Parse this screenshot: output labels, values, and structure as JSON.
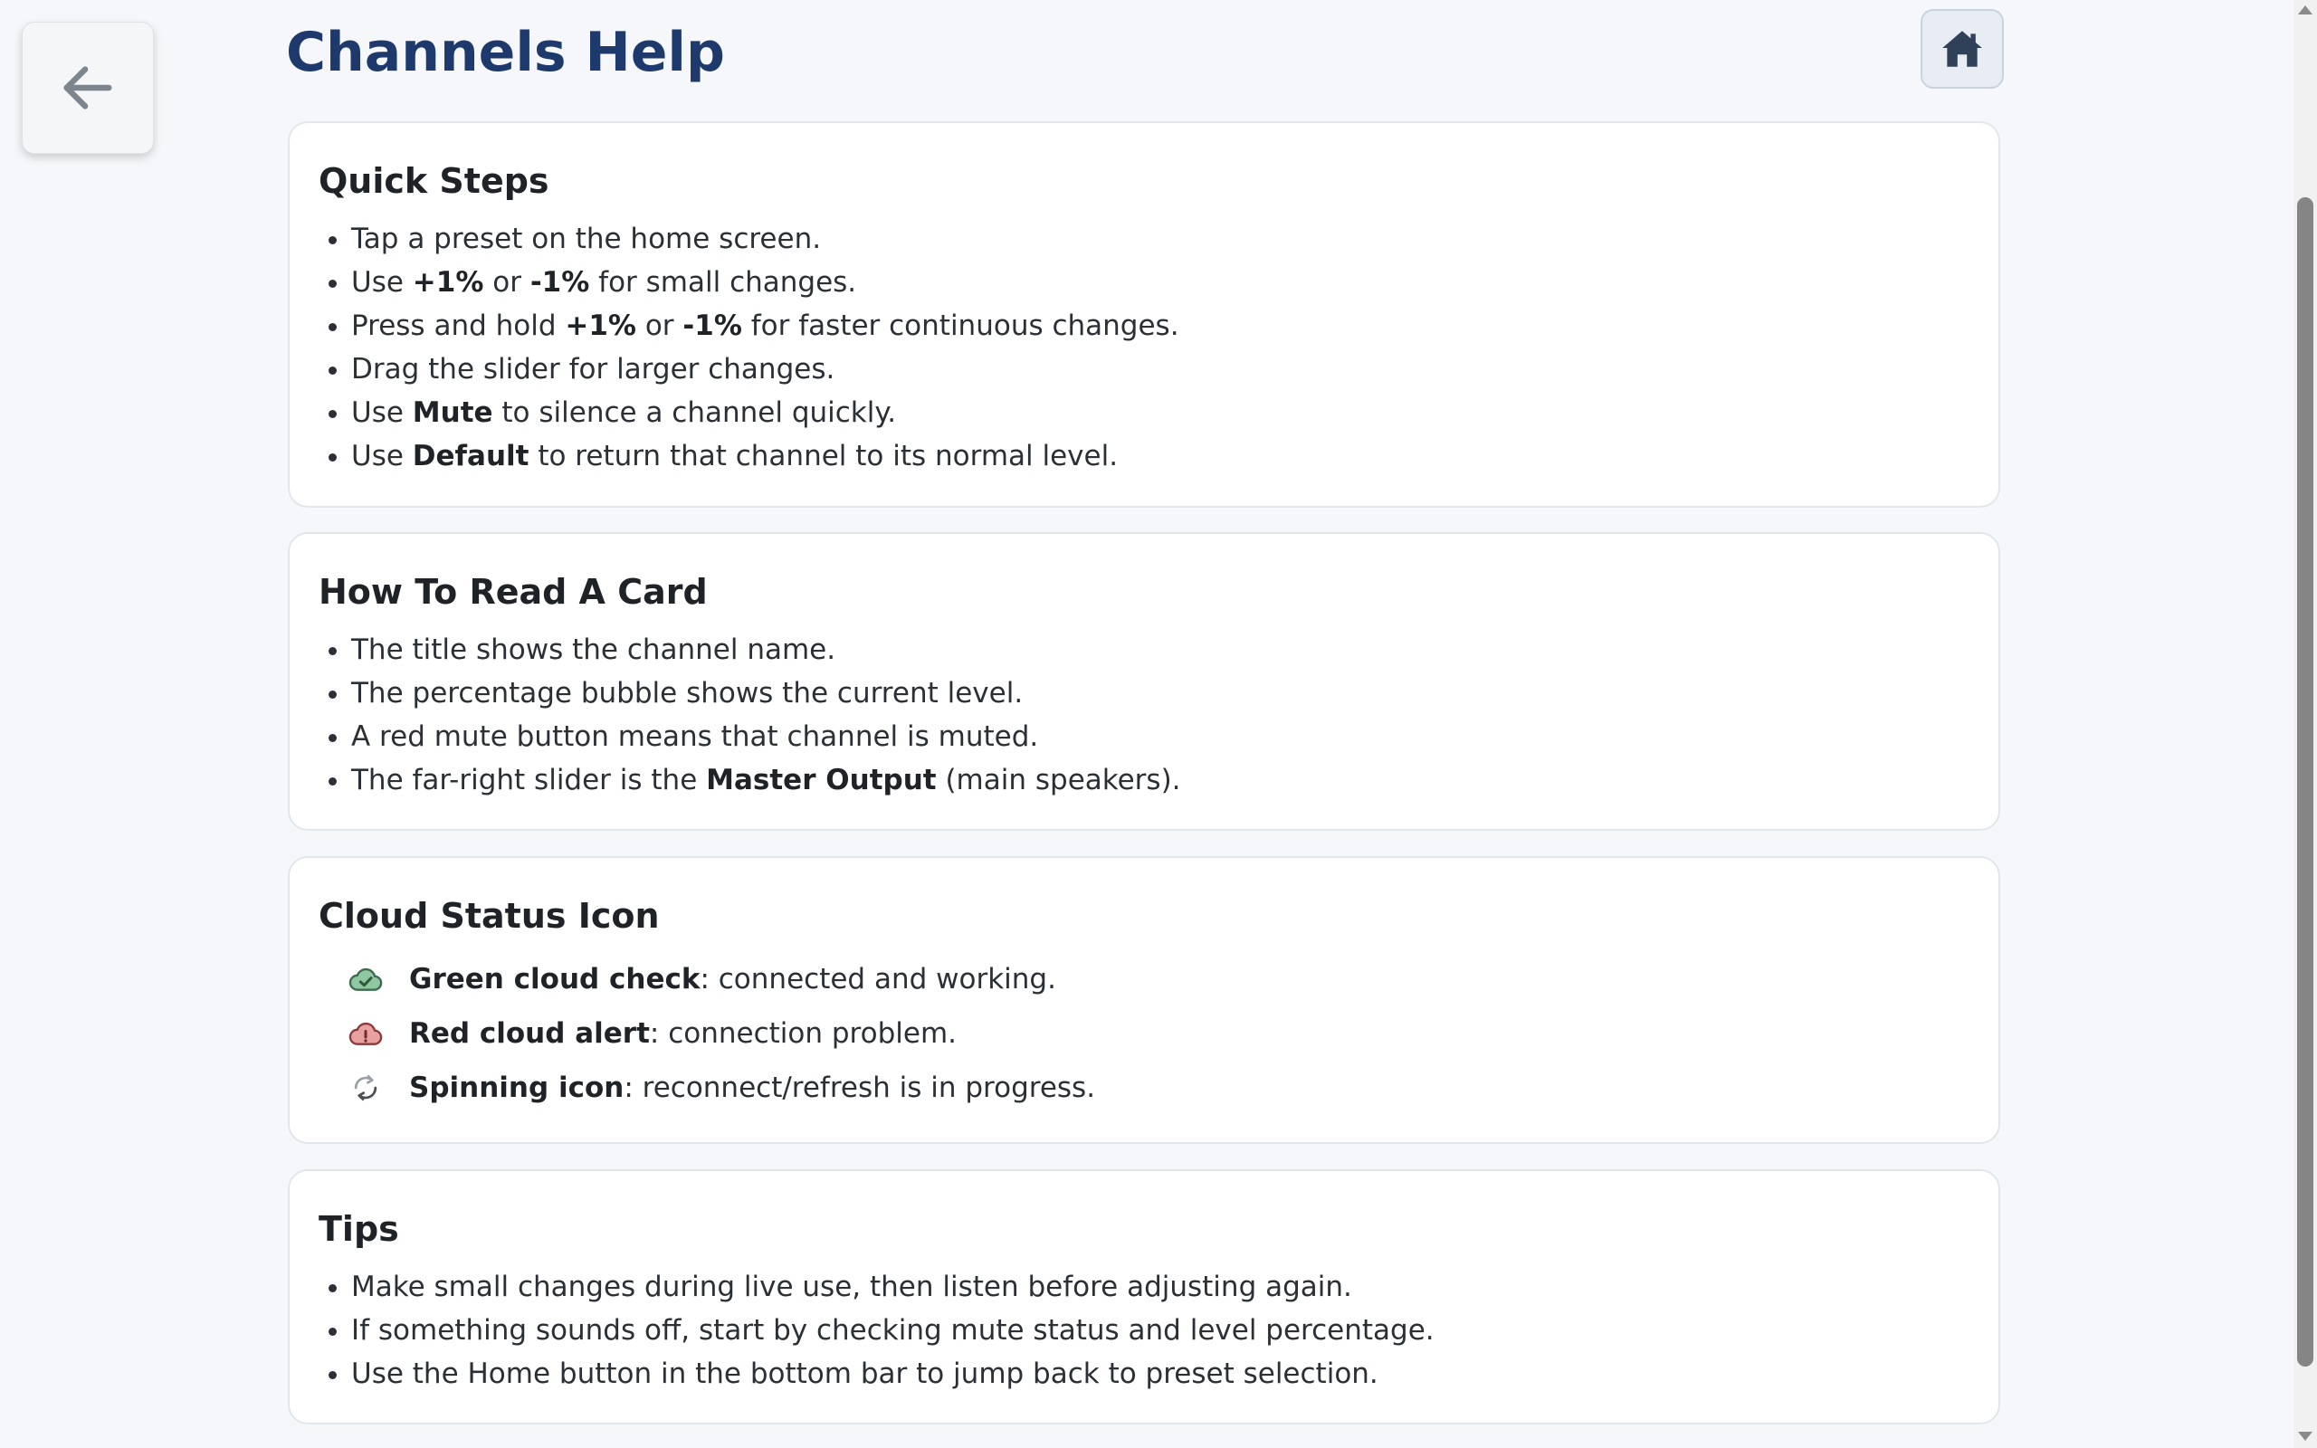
{
  "header": {
    "title": "Channels Help"
  },
  "icons": {
    "back": "arrow-left-icon",
    "home": "home-icon"
  },
  "colors": {
    "title": "#1e3a6d",
    "cloud_ok": "#3f8f5a",
    "cloud_alert": "#c0392b"
  },
  "quick_steps": {
    "heading": "Quick Steps",
    "items": [
      {
        "pre": "Tap a preset on the home screen.",
        "b1": "",
        "mid": "",
        "b2": "",
        "post": ""
      },
      {
        "pre": "Use ",
        "b1": "+1%",
        "mid": " or ",
        "b2": "-1%",
        "post": " for small changes."
      },
      {
        "pre": "Press and hold ",
        "b1": "+1%",
        "mid": " or ",
        "b2": "-1%",
        "post": " for faster continuous changes."
      },
      {
        "pre": "Drag the slider for larger changes.",
        "b1": "",
        "mid": "",
        "b2": "",
        "post": ""
      },
      {
        "pre": "Use ",
        "b1": "Mute",
        "mid": " to silence a channel quickly.",
        "b2": "",
        "post": ""
      },
      {
        "pre": "Use ",
        "b1": "Default",
        "mid": " to return that channel to its normal level.",
        "b2": "",
        "post": ""
      }
    ]
  },
  "read_card": {
    "heading": "How To Read A Card",
    "items": [
      {
        "pre": "The title shows the channel name.",
        "b1": "",
        "post": ""
      },
      {
        "pre": "The percentage bubble shows the current level.",
        "b1": "",
        "post": ""
      },
      {
        "pre": "A red mute button means that channel is muted.",
        "b1": "",
        "post": ""
      },
      {
        "pre": "The far-right slider is the ",
        "b1": "Master Output",
        "post": " (main speakers)."
      }
    ]
  },
  "cloud_status": {
    "heading": "Cloud Status Icon",
    "rows": [
      {
        "icon": "cloud-check-icon",
        "label": "Green cloud check",
        "desc": ": connected and working."
      },
      {
        "icon": "cloud-alert-icon",
        "label": "Red cloud alert",
        "desc": ": connection problem."
      },
      {
        "icon": "refresh-spin-icon",
        "label": "Spinning icon",
        "desc": ": reconnect/refresh is in progress."
      }
    ]
  },
  "tips": {
    "heading": "Tips",
    "items": [
      "Make small changes during live use, then listen before adjusting again.",
      "If something sounds off, start by checking mute status and level percentage.",
      "Use the Home button in the bottom bar to jump back to preset selection."
    ]
  }
}
